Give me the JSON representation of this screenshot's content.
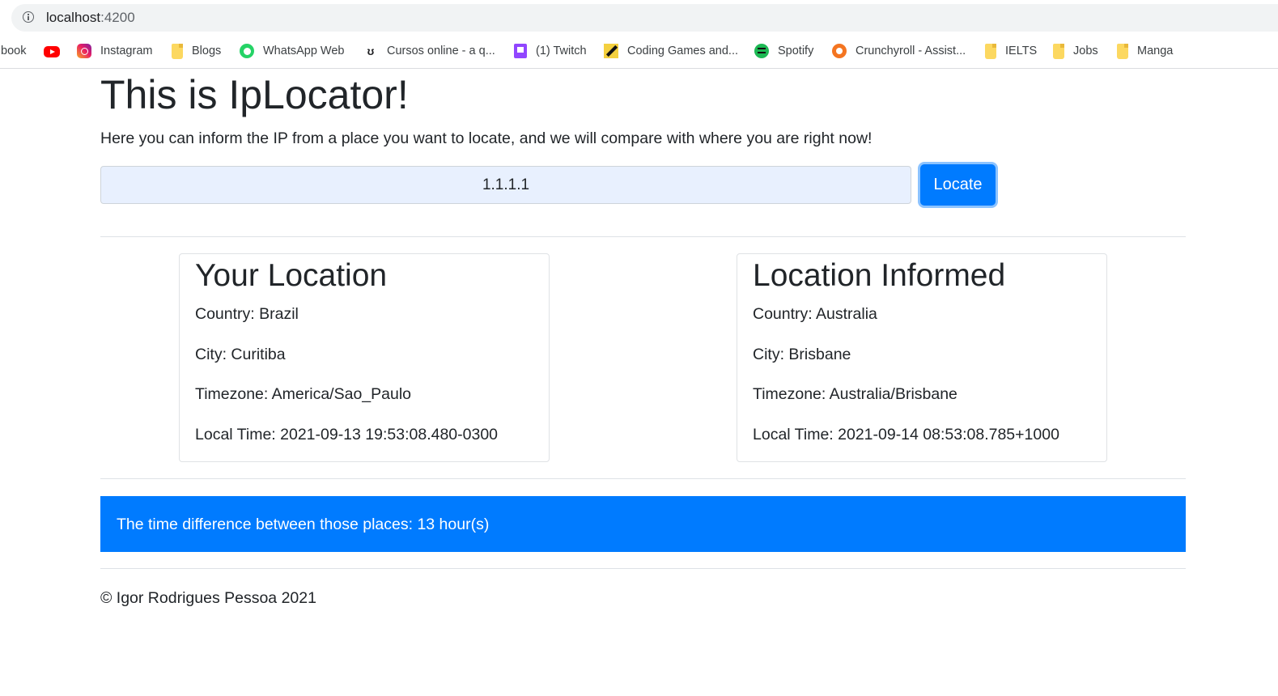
{
  "browser": {
    "url_host": "localhost",
    "url_port": ":4200",
    "bookmarks": [
      {
        "label": "book",
        "icon": "none"
      },
      {
        "label": "",
        "icon": "youtube-icon"
      },
      {
        "label": "Instagram",
        "icon": "instagram-icon"
      },
      {
        "label": "Blogs",
        "icon": "folder-icon"
      },
      {
        "label": "WhatsApp Web",
        "icon": "whatsapp-icon"
      },
      {
        "label": "Cursos online - a q...",
        "icon": "udemy-icon"
      },
      {
        "label": "(1) Twitch",
        "icon": "twitch-icon"
      },
      {
        "label": "Coding Games and...",
        "icon": "codingame-icon"
      },
      {
        "label": "Spotify",
        "icon": "spotify-icon"
      },
      {
        "label": "Crunchyroll - Assist...",
        "icon": "crunchyroll-icon"
      },
      {
        "label": "IELTS",
        "icon": "folder-icon"
      },
      {
        "label": "Jobs",
        "icon": "folder-icon"
      },
      {
        "label": "Manga",
        "icon": "folder-icon"
      }
    ]
  },
  "header": {
    "title": "This is IpLocator!",
    "lead": "Here you can inform the IP from a place you want to locate, and we will compare with where you are right now!"
  },
  "search": {
    "value": "1.1.1.1",
    "button_label": "Locate"
  },
  "your_location": {
    "title": "Your Location",
    "country": "Country: Brazil",
    "city": "City: Curitiba",
    "timezone": "Timezone: America/Sao_Paulo",
    "local_time": "Local Time: 2021-09-13 19:53:08.480-0300"
  },
  "informed_location": {
    "title": "Location Informed",
    "country": "Country: Australia",
    "city": "City: Brisbane",
    "timezone": "Timezone: Australia/Brisbane",
    "local_time": "Local Time: 2021-09-14 08:53:08.785+1000"
  },
  "result": {
    "text": "The time difference between those places: 13 hour(s)"
  },
  "footer": {
    "text": "© Igor Rodrigues Pessoa 2021"
  },
  "colors": {
    "primary": "#007bff",
    "input_bg": "#e8f0fe",
    "text": "#212529"
  }
}
